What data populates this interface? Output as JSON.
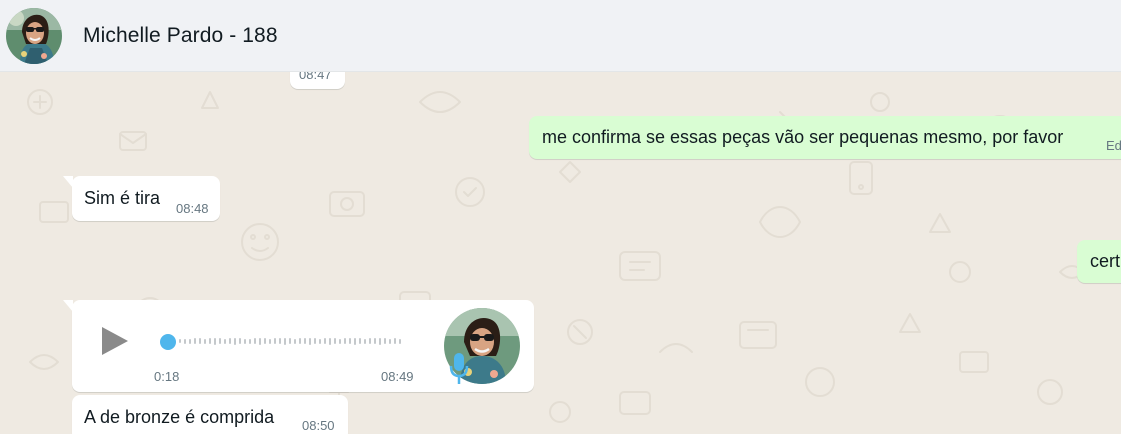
{
  "header": {
    "contact_name": "Michelle Pardo - 188",
    "avatar_icon": "contact-avatar"
  },
  "messages": [
    {
      "direction": "in",
      "type": "text",
      "time": "08:47"
    },
    {
      "direction": "out",
      "type": "text",
      "text": "me confirma se essas peças vão ser pequenas mesmo, por favor",
      "edited_label": "Ed"
    },
    {
      "direction": "in",
      "type": "text",
      "text": "Sim é tira",
      "time": "08:48"
    },
    {
      "direction": "out",
      "type": "text",
      "text": "cert"
    },
    {
      "direction": "in",
      "type": "voice",
      "duration": "0:18",
      "time": "08:49",
      "progress": 0,
      "icons": [
        "play-icon",
        "mic-icon"
      ]
    },
    {
      "direction": "in",
      "type": "text",
      "text": "A de bronze é comprida",
      "time": "08:50"
    }
  ],
  "colors": {
    "header_bg": "#f0f2f5",
    "chat_bg": "#efeae2",
    "incoming_bubble": "#ffffff",
    "outgoing_bubble": "#d9fdd3",
    "voice_knob": "#4fb6ec",
    "mic": "#4fb6ec"
  }
}
